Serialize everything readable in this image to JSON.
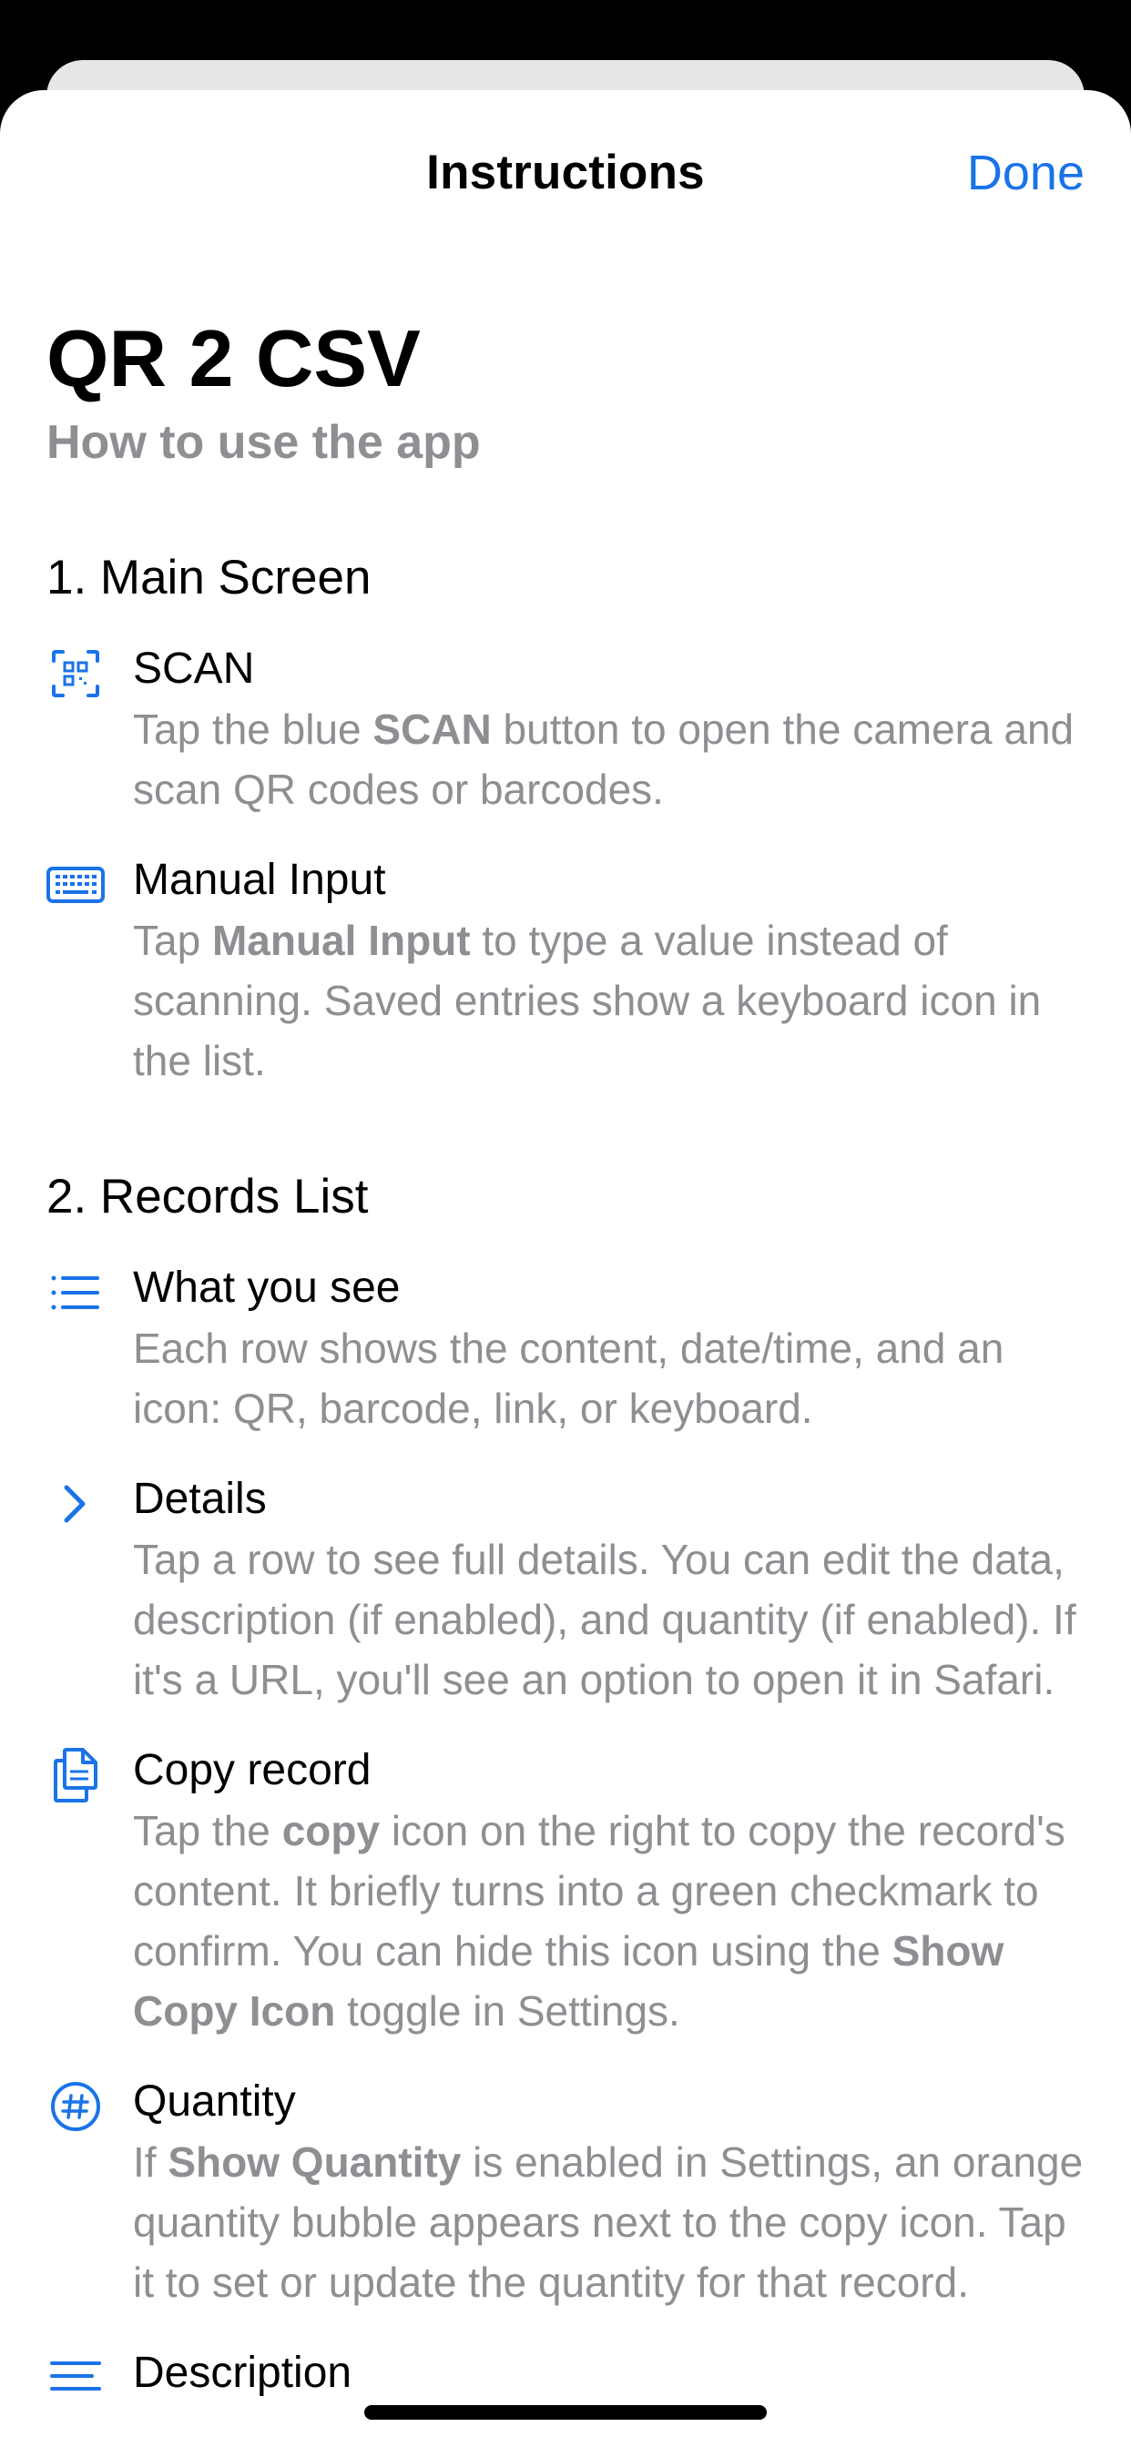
{
  "nav": {
    "title": "Instructions",
    "done_label": "Done"
  },
  "header": {
    "app_title": "QR 2 CSV",
    "subtitle": "How to use the app"
  },
  "sections": [
    {
      "title": "1. Main Screen",
      "items": [
        {
          "icon": "qr-scan-icon",
          "title": "SCAN",
          "desc": [
            {
              "t": "Tap the blue "
            },
            {
              "t": "SCAN",
              "b": true
            },
            {
              "t": " button to open the camera and scan QR codes or barcodes."
            }
          ]
        },
        {
          "icon": "keyboard-icon",
          "title": "Manual Input",
          "desc": [
            {
              "t": "Tap "
            },
            {
              "t": "Manual Input",
              "b": true
            },
            {
              "t": " to type a value instead of scanning. Saved entries show a keyboard icon in the list."
            }
          ]
        }
      ]
    },
    {
      "title": "2. Records List",
      "items": [
        {
          "icon": "list-icon",
          "title": "What you see",
          "desc": [
            {
              "t": "Each row shows the content, date/time, and an icon: QR, barcode, link, or keyboard."
            }
          ]
        },
        {
          "icon": "chevron-right-icon",
          "title": "Details",
          "desc": [
            {
              "t": "Tap a row to see full details. You can edit the data, description (if enabled), and quantity (if enabled). If it's a URL, you'll see an option to open it in Safari."
            }
          ]
        },
        {
          "icon": "copy-icon",
          "title": "Copy record",
          "desc": [
            {
              "t": "Tap the "
            },
            {
              "t": "copy",
              "b": true
            },
            {
              "t": " icon on the right to copy the record's content. It briefly turns into a green checkmark to confirm. You can hide this icon using the "
            },
            {
              "t": "Show Copy Icon",
              "b": true
            },
            {
              "t": " toggle in Settings."
            }
          ]
        },
        {
          "icon": "number-circle-icon",
          "title": "Quantity",
          "desc": [
            {
              "t": "If "
            },
            {
              "t": "Show Quantity",
              "b": true
            },
            {
              "t": " is enabled in Settings, an orange quantity bubble appears next to the copy icon. Tap it to set or update the quantity for that record."
            }
          ]
        },
        {
          "icon": "text-lines-icon",
          "title": "Description",
          "desc": []
        }
      ]
    }
  ],
  "colors": {
    "accent": "#1a73e8",
    "secondary_text": "#8e8e93"
  }
}
